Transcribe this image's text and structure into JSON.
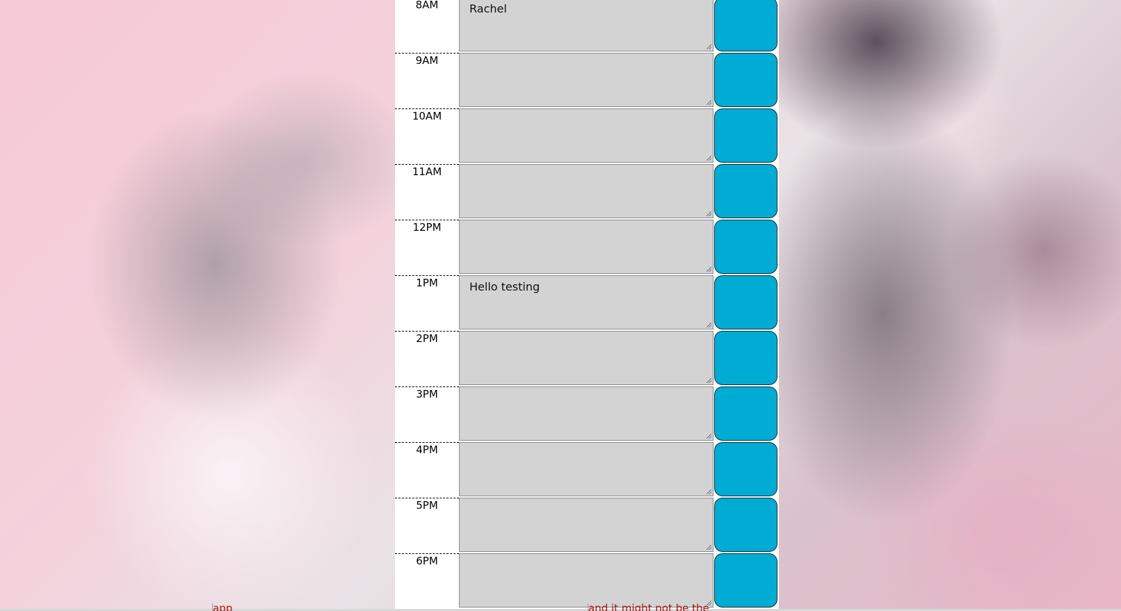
{
  "rows": [
    {
      "hour": "8AM",
      "note": "Rachel"
    },
    {
      "hour": "9AM",
      "note": ""
    },
    {
      "hour": "10AM",
      "note": ""
    },
    {
      "hour": "11AM",
      "note": ""
    },
    {
      "hour": "12PM",
      "note": ""
    },
    {
      "hour": "1PM",
      "note": "Hello testing"
    },
    {
      "hour": "2PM",
      "note": ""
    },
    {
      "hour": "3PM",
      "note": ""
    },
    {
      "hour": "4PM",
      "note": ""
    },
    {
      "hour": "5PM",
      "note": ""
    },
    {
      "hour": "6PM",
      "note": ""
    }
  ],
  "footer": {
    "cell_a": "app",
    "cell_b": "and it might not be the"
  },
  "colors": {
    "save_button": "#00acd4",
    "note_background": "#d3d3d3"
  }
}
